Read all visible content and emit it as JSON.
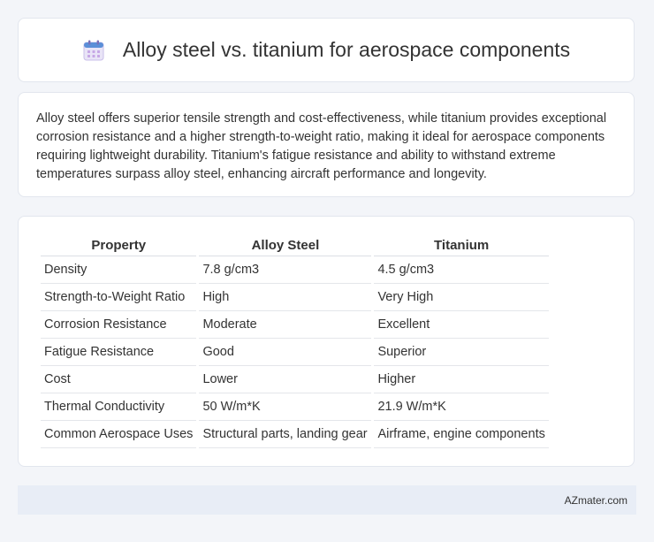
{
  "header": {
    "icon": "calendar-icon",
    "title": "Alloy steel vs. titanium for aerospace components"
  },
  "summary": {
    "text": "Alloy steel offers superior tensile strength and cost-effectiveness, while titanium provides exceptional corrosion resistance and a higher strength-to-weight ratio, making it ideal for aerospace components requiring lightweight durability. Titanium's fatigue resistance and ability to withstand extreme temperatures surpass alloy steel, enhancing aircraft performance and longevity."
  },
  "table": {
    "headers": [
      "Property",
      "Alloy Steel",
      "Titanium"
    ],
    "rows": [
      [
        "Density",
        "7.8 g/cm3",
        "4.5 g/cm3"
      ],
      [
        "Strength-to-Weight Ratio",
        "High",
        "Very High"
      ],
      [
        "Corrosion Resistance",
        "Moderate",
        "Excellent"
      ],
      [
        "Fatigue Resistance",
        "Good",
        "Superior"
      ],
      [
        "Cost",
        "Lower",
        "Higher"
      ],
      [
        "Thermal Conductivity",
        "50 W/m*K",
        "21.9 W/m*K"
      ],
      [
        "Common Aerospace Uses",
        "Structural parts, landing gear",
        "Airframe, engine components"
      ]
    ]
  },
  "footer": {
    "site": "AZmater.com"
  },
  "colors": {
    "background": "#f3f5f9",
    "card": "#ffffff",
    "footer_bg": "#e8edf6",
    "icon_accent": "#4a90d9"
  }
}
